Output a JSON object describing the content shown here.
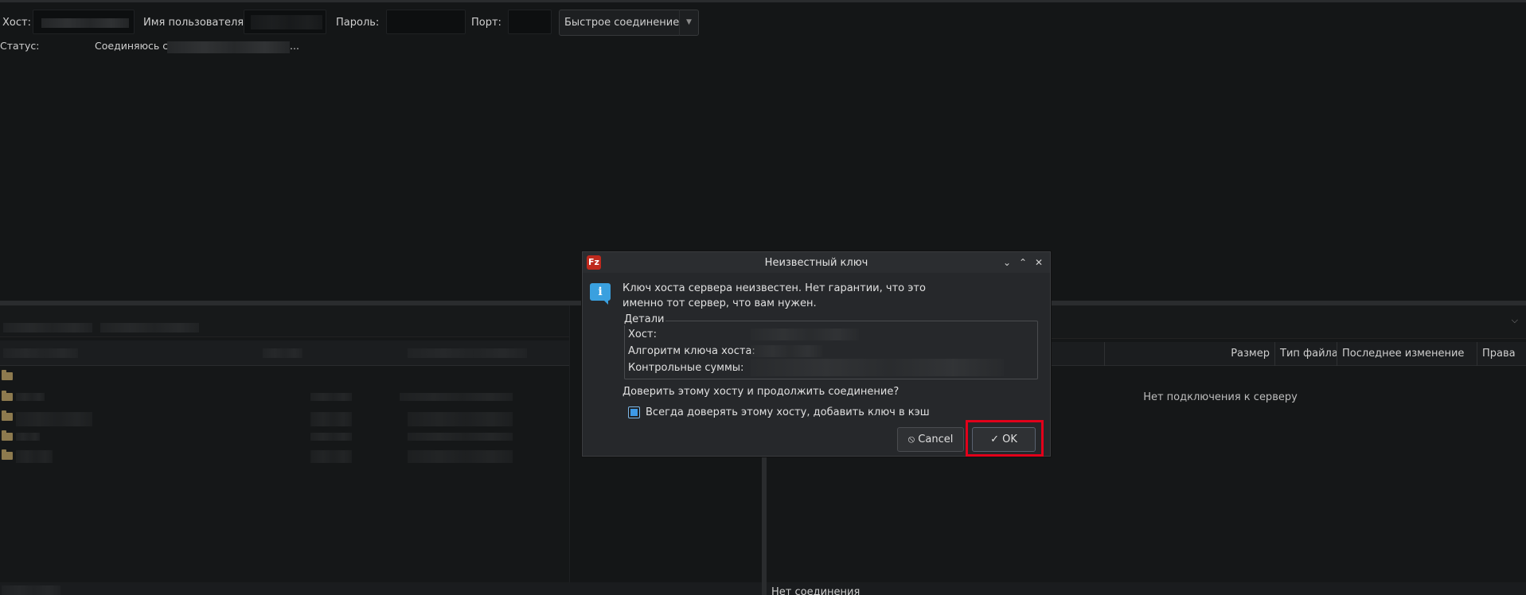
{
  "quickconnect": {
    "host_label": "Хост:",
    "user_label": "Имя пользователя",
    "password_label": "Пароль:",
    "port_label": "Порт:",
    "connect_button": "Быстрое соединение"
  },
  "log": {
    "status_label": "Статус:",
    "status_text_prefix": "Соединяюсь с",
    "status_text_suffix": "..."
  },
  "remote": {
    "columns": [
      "Размер",
      "Тип файла",
      "Последнее изменение",
      "Права"
    ],
    "empty_message": "Нет подключения к серверу",
    "status": "Нет соединения"
  },
  "dialog": {
    "title": "Неизвестный ключ",
    "message_line1": "Ключ хоста сервера неизвестен. Нет гарантии, что это",
    "message_line2": "именно тот сервер, что вам нужен.",
    "details_legend": "Детали",
    "host_label": "Хост:",
    "algorithm_label": "Алгоритм ключа хоста:",
    "checksums_label": "Контрольные суммы:",
    "question": "Доверить этому хосту и продолжить соединение?",
    "always_trust_label": "Всегда доверять этому хосту, добавить ключ в кэш",
    "always_trust_checked": true,
    "cancel_label": "Cancel",
    "ok_label": "OK"
  },
  "icons": {
    "app_logo": "filezilla-logo-icon",
    "info": "info-icon",
    "cancel": "cancel-icon",
    "ok": "check-icon"
  },
  "colors": {
    "highlight": "#e2001a",
    "checkbox": "#3d9ae8",
    "logo": "#bf2a1e"
  }
}
